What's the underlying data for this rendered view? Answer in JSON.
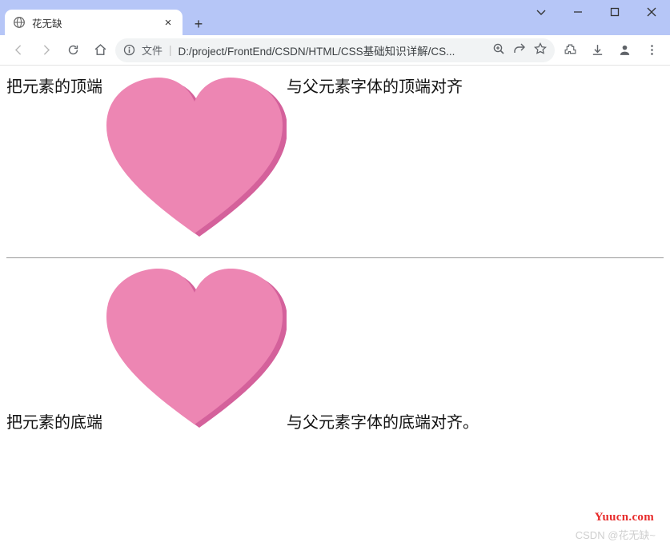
{
  "window": {
    "tab_title": "花无缺",
    "file_label": "文件",
    "url_display": "D:/project/FrontEnd/CSDN/HTML/CSS基础知识详解/CS..."
  },
  "content": {
    "line1_before": "把元素的顶端",
    "line1_after": "与父元素字体的顶端对齐",
    "line2_before": "把元素的底端",
    "line2_after": "与父元素字体的底端对齐。"
  },
  "watermark": {
    "site": "Yuucn.com",
    "credit": "CSDN @花无缺~"
  }
}
